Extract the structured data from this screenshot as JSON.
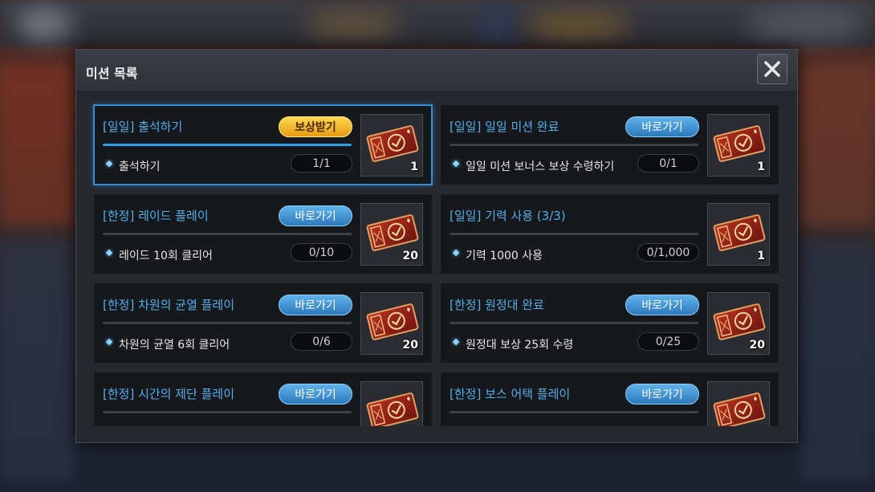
{
  "window": {
    "title": "미션 목록",
    "close_icon": "close-icon"
  },
  "missions": [
    {
      "title": "[일일] 출석하기",
      "button": "보상받기",
      "button_type": "claim",
      "subtitle": "출석하기",
      "progress": "1/1",
      "progress_fraction": 1.0,
      "reward_icon": "ticket-icon",
      "reward_count": "1",
      "selected": true
    },
    {
      "title": "[일일] 일일 미션 완료",
      "button": "바로가기",
      "button_type": "go",
      "subtitle": "일일 미션 보너스 보상 수령하기",
      "progress": "0/1",
      "progress_fraction": 0,
      "reward_icon": "ticket-icon",
      "reward_count": "1",
      "selected": false
    },
    {
      "title": "[한정] 레이드 플레이",
      "button": "바로가기",
      "button_type": "go",
      "subtitle": "레이드 10회 클리어",
      "progress": "0/10",
      "progress_fraction": 0,
      "reward_icon": "ticket-icon",
      "reward_count": "20",
      "selected": false
    },
    {
      "title": "[일일] 기력 사용 (3/3)",
      "button": "",
      "button_type": "none",
      "subtitle": "기력 1000 사용",
      "progress": "0/1,000",
      "progress_fraction": 0,
      "reward_icon": "ticket-icon",
      "reward_count": "1",
      "selected": false
    },
    {
      "title": "[한정] 차원의 균열 플레이",
      "button": "바로가기",
      "button_type": "go",
      "subtitle": "차원의 균열 6회 클리어",
      "progress": "0/6",
      "progress_fraction": 0,
      "reward_icon": "ticket-icon",
      "reward_count": "20",
      "selected": false
    },
    {
      "title": "[한정] 원정대 완료",
      "button": "바로가기",
      "button_type": "go",
      "subtitle": "원정대 보상 25회 수령",
      "progress": "0/25",
      "progress_fraction": 0,
      "reward_icon": "ticket-icon",
      "reward_count": "20",
      "selected": false
    },
    {
      "title": "[한정] 시간의 제단 플레이",
      "button": "바로가기",
      "button_type": "go",
      "subtitle": "",
      "progress": "",
      "progress_fraction": 0,
      "reward_icon": "ticket-icon",
      "reward_count": "",
      "selected": false
    },
    {
      "title": "[한정] 보스 어택 플레이",
      "button": "바로가기",
      "button_type": "go",
      "subtitle": "",
      "progress": "",
      "progress_fraction": 0,
      "reward_icon": "ticket-icon",
      "reward_count": "",
      "selected": false
    }
  ],
  "colors": {
    "title_blue": "#4fb0ec",
    "go_button": "#3a8fd3",
    "claim_button": "#f5b421",
    "selected_border": "#2f8ed6"
  }
}
